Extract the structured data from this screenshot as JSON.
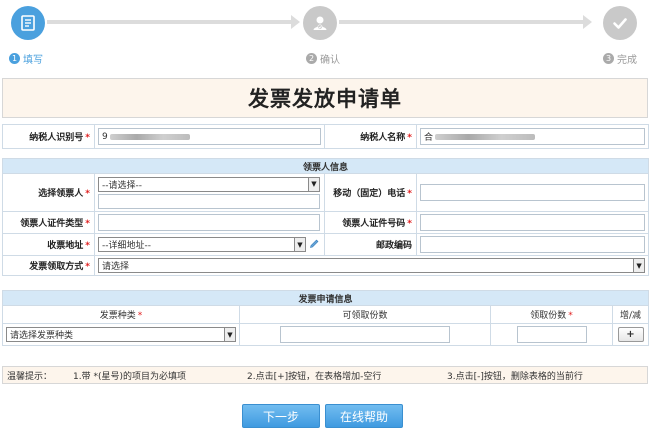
{
  "steps": [
    {
      "num": "1",
      "label": "填写"
    },
    {
      "num": "2",
      "label": "确认"
    },
    {
      "num": "3",
      "label": "完成"
    }
  ],
  "form": {
    "title": "发票发放申请单",
    "taxpayer_id_label": "纳税人识别号",
    "taxpayer_id_value": "9",
    "taxpayer_name_label": "纳税人名称",
    "taxpayer_name_value": "合"
  },
  "recipient": {
    "section_title": "领票人信息",
    "select_recipient_label": "选择领票人",
    "select_recipient_value": "--请选择--",
    "phone_label": "移动（固定）电话",
    "id_type_label": "领票人证件类型",
    "id_number_label": "领票人证件号码",
    "address_label": "收票地址",
    "address_value": "--详细地址--",
    "postcode_label": "邮政编码",
    "pickup_method_label": "发票领取方式",
    "pickup_method_value": "请选择"
  },
  "invoice": {
    "section_title": "发票申请信息",
    "col_type": "发票种类",
    "col_available": "可领取份数",
    "col_count": "领取份数",
    "col_add_remove": "增/减",
    "type_value": "请选择发票种类",
    "add_button": "+"
  },
  "tips": {
    "label": "温馨提示：",
    "tip1": "1.带 *(星号)的项目为必填项",
    "tip2": "2.点击[+]按钮，在表格增加-空行",
    "tip3": "3.点击[-]按钮，删除表格的当前行"
  },
  "buttons": {
    "next": "下一步",
    "help": "在线帮助"
  },
  "required_mark": "*",
  "colors": {
    "accent": "#4aa0de",
    "section_bg": "#d5e8f7",
    "title_bg": "#fdf5ec",
    "required": "#e02020"
  },
  "icons": {
    "step1": "form-edit-icon",
    "step2": "user-check-icon",
    "step3": "checkmark-icon",
    "address_edit": "pencil-icon"
  }
}
